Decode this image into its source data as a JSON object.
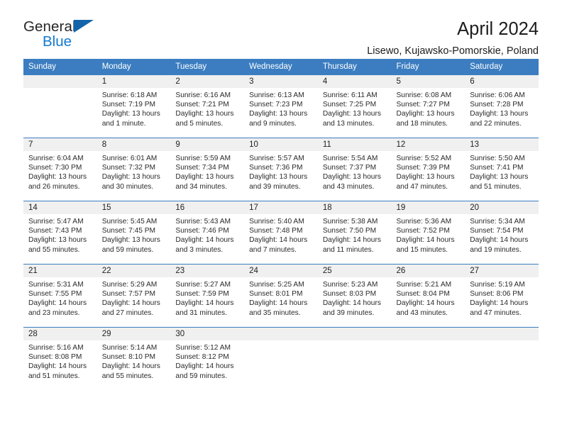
{
  "logo": {
    "word_top": "General",
    "word_bottom": "Blue",
    "triangle_color": "#1464aa",
    "blue_color": "#1479cf"
  },
  "header": {
    "title": "April 2024",
    "subtitle": "Lisewo, Kujawsko-Pomorskie, Poland"
  },
  "theme": {
    "header_bg": "#3b7dc0",
    "daynum_bg": "#f0f0f0",
    "text": "#222222"
  },
  "weekdays": [
    "Sunday",
    "Monday",
    "Tuesday",
    "Wednesday",
    "Thursday",
    "Friday",
    "Saturday"
  ],
  "labels": {
    "sunrise": "Sunrise:",
    "sunset": "Sunset:",
    "daylight": "Daylight:"
  },
  "weeks": [
    [
      {
        "day": "",
        "empty": true
      },
      {
        "day": "1",
        "sunrise": "Sunrise: 6:18 AM",
        "sunset": "Sunset: 7:19 PM",
        "daylight_1": "Daylight: 13 hours",
        "daylight_2": "and 1 minute."
      },
      {
        "day": "2",
        "sunrise": "Sunrise: 6:16 AM",
        "sunset": "Sunset: 7:21 PM",
        "daylight_1": "Daylight: 13 hours",
        "daylight_2": "and 5 minutes."
      },
      {
        "day": "3",
        "sunrise": "Sunrise: 6:13 AM",
        "sunset": "Sunset: 7:23 PM",
        "daylight_1": "Daylight: 13 hours",
        "daylight_2": "and 9 minutes."
      },
      {
        "day": "4",
        "sunrise": "Sunrise: 6:11 AM",
        "sunset": "Sunset: 7:25 PM",
        "daylight_1": "Daylight: 13 hours",
        "daylight_2": "and 13 minutes."
      },
      {
        "day": "5",
        "sunrise": "Sunrise: 6:08 AM",
        "sunset": "Sunset: 7:27 PM",
        "daylight_1": "Daylight: 13 hours",
        "daylight_2": "and 18 minutes."
      },
      {
        "day": "6",
        "sunrise": "Sunrise: 6:06 AM",
        "sunset": "Sunset: 7:28 PM",
        "daylight_1": "Daylight: 13 hours",
        "daylight_2": "and 22 minutes."
      }
    ],
    [
      {
        "day": "7",
        "sunrise": "Sunrise: 6:04 AM",
        "sunset": "Sunset: 7:30 PM",
        "daylight_1": "Daylight: 13 hours",
        "daylight_2": "and 26 minutes."
      },
      {
        "day": "8",
        "sunrise": "Sunrise: 6:01 AM",
        "sunset": "Sunset: 7:32 PM",
        "daylight_1": "Daylight: 13 hours",
        "daylight_2": "and 30 minutes."
      },
      {
        "day": "9",
        "sunrise": "Sunrise: 5:59 AM",
        "sunset": "Sunset: 7:34 PM",
        "daylight_1": "Daylight: 13 hours",
        "daylight_2": "and 34 minutes."
      },
      {
        "day": "10",
        "sunrise": "Sunrise: 5:57 AM",
        "sunset": "Sunset: 7:36 PM",
        "daylight_1": "Daylight: 13 hours",
        "daylight_2": "and 39 minutes."
      },
      {
        "day": "11",
        "sunrise": "Sunrise: 5:54 AM",
        "sunset": "Sunset: 7:37 PM",
        "daylight_1": "Daylight: 13 hours",
        "daylight_2": "and 43 minutes."
      },
      {
        "day": "12",
        "sunrise": "Sunrise: 5:52 AM",
        "sunset": "Sunset: 7:39 PM",
        "daylight_1": "Daylight: 13 hours",
        "daylight_2": "and 47 minutes."
      },
      {
        "day": "13",
        "sunrise": "Sunrise: 5:50 AM",
        "sunset": "Sunset: 7:41 PM",
        "daylight_1": "Daylight: 13 hours",
        "daylight_2": "and 51 minutes."
      }
    ],
    [
      {
        "day": "14",
        "sunrise": "Sunrise: 5:47 AM",
        "sunset": "Sunset: 7:43 PM",
        "daylight_1": "Daylight: 13 hours",
        "daylight_2": "and 55 minutes."
      },
      {
        "day": "15",
        "sunrise": "Sunrise: 5:45 AM",
        "sunset": "Sunset: 7:45 PM",
        "daylight_1": "Daylight: 13 hours",
        "daylight_2": "and 59 minutes."
      },
      {
        "day": "16",
        "sunrise": "Sunrise: 5:43 AM",
        "sunset": "Sunset: 7:46 PM",
        "daylight_1": "Daylight: 14 hours",
        "daylight_2": "and 3 minutes."
      },
      {
        "day": "17",
        "sunrise": "Sunrise: 5:40 AM",
        "sunset": "Sunset: 7:48 PM",
        "daylight_1": "Daylight: 14 hours",
        "daylight_2": "and 7 minutes."
      },
      {
        "day": "18",
        "sunrise": "Sunrise: 5:38 AM",
        "sunset": "Sunset: 7:50 PM",
        "daylight_1": "Daylight: 14 hours",
        "daylight_2": "and 11 minutes."
      },
      {
        "day": "19",
        "sunrise": "Sunrise: 5:36 AM",
        "sunset": "Sunset: 7:52 PM",
        "daylight_1": "Daylight: 14 hours",
        "daylight_2": "and 15 minutes."
      },
      {
        "day": "20",
        "sunrise": "Sunrise: 5:34 AM",
        "sunset": "Sunset: 7:54 PM",
        "daylight_1": "Daylight: 14 hours",
        "daylight_2": "and 19 minutes."
      }
    ],
    [
      {
        "day": "21",
        "sunrise": "Sunrise: 5:31 AM",
        "sunset": "Sunset: 7:55 PM",
        "daylight_1": "Daylight: 14 hours",
        "daylight_2": "and 23 minutes."
      },
      {
        "day": "22",
        "sunrise": "Sunrise: 5:29 AM",
        "sunset": "Sunset: 7:57 PM",
        "daylight_1": "Daylight: 14 hours",
        "daylight_2": "and 27 minutes."
      },
      {
        "day": "23",
        "sunrise": "Sunrise: 5:27 AM",
        "sunset": "Sunset: 7:59 PM",
        "daylight_1": "Daylight: 14 hours",
        "daylight_2": "and 31 minutes."
      },
      {
        "day": "24",
        "sunrise": "Sunrise: 5:25 AM",
        "sunset": "Sunset: 8:01 PM",
        "daylight_1": "Daylight: 14 hours",
        "daylight_2": "and 35 minutes."
      },
      {
        "day": "25",
        "sunrise": "Sunrise: 5:23 AM",
        "sunset": "Sunset: 8:03 PM",
        "daylight_1": "Daylight: 14 hours",
        "daylight_2": "and 39 minutes."
      },
      {
        "day": "26",
        "sunrise": "Sunrise: 5:21 AM",
        "sunset": "Sunset: 8:04 PM",
        "daylight_1": "Daylight: 14 hours",
        "daylight_2": "and 43 minutes."
      },
      {
        "day": "27",
        "sunrise": "Sunrise: 5:19 AM",
        "sunset": "Sunset: 8:06 PM",
        "daylight_1": "Daylight: 14 hours",
        "daylight_2": "and 47 minutes."
      }
    ],
    [
      {
        "day": "28",
        "sunrise": "Sunrise: 5:16 AM",
        "sunset": "Sunset: 8:08 PM",
        "daylight_1": "Daylight: 14 hours",
        "daylight_2": "and 51 minutes."
      },
      {
        "day": "29",
        "sunrise": "Sunrise: 5:14 AM",
        "sunset": "Sunset: 8:10 PM",
        "daylight_1": "Daylight: 14 hours",
        "daylight_2": "and 55 minutes."
      },
      {
        "day": "30",
        "sunrise": "Sunrise: 5:12 AM",
        "sunset": "Sunset: 8:12 PM",
        "daylight_1": "Daylight: 14 hours",
        "daylight_2": "and 59 minutes."
      },
      {
        "day": "",
        "empty": true
      },
      {
        "day": "",
        "empty": true
      },
      {
        "day": "",
        "empty": true
      },
      {
        "day": "",
        "empty": true
      }
    ]
  ]
}
